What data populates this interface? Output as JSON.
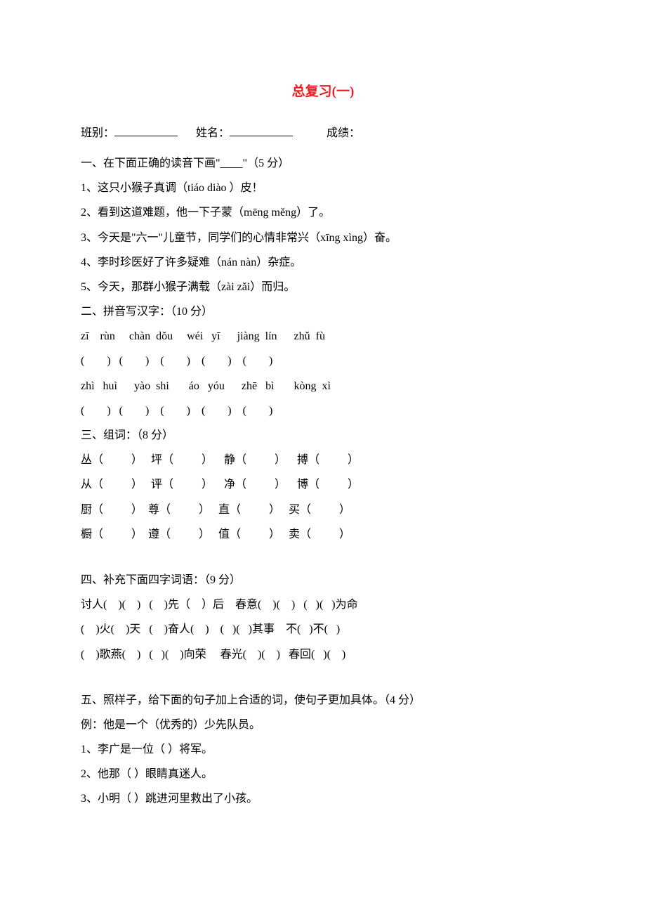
{
  "title": "总复习(一)",
  "header": {
    "class_label": "班别：",
    "name_label": "姓名：",
    "score_label": "成绩："
  },
  "section1": {
    "label": "一、在下面正确的读音下画\"____\"（5 分）",
    "items": [
      "1、这只小猴子真调（tiáo   diào  ）皮！",
      "2、看到这道难题，他一下子蒙（mēng  měng）了。",
      "3、今天是\"六一\"儿童节，同学们的心情非常兴（xīng xìng）奋。",
      "4、李时珍医好了许多疑难（nán   nàn）杂症。",
      "5、今天，那群小猴子满载（zài  zǎi）而归。"
    ]
  },
  "section2": {
    "label": "二、拼音写汉字：（10 分）",
    "row1_pinyin": "zī    rùn     chàn  dǒu     wéi   yī      jiàng  lín      zhǔ  fù",
    "row1_paren": "(        )   (        )    (        )    (        )    (        )",
    "row2_pinyin": "zhì   huì      yào  shi       áo   yóu      zhē   bì       kòng  xì",
    "row2_paren": "(        )   (        )    (        )    (        )    (        )"
  },
  "section3": {
    "label": "三、组词：（8 分）",
    "rows": [
      "丛（          ）   坪（          ）    静（          ）    搏（          ）",
      "从（          ）   评（          ）    净（          ）    博（          ）",
      "厨（          ）  尊（          ）   直（          ）   买（          ）",
      "橱（          ）  遵（          ）   值（          ）   卖（          ）"
    ]
  },
  "section4": {
    "label": "四、补充下面四字词语：（9 分）",
    "rows": [
      "讨人(    )(    )   (    )先（    ）后    春意(    )(    )   (   )(   )为命",
      "(    )火(    )天   (    )奋人(    )    (   )(   )其事    不(   )不(   )",
      "(    )歌燕(    )   (   )(    )向荣     春光(    )(    )   春回(   )(    )"
    ]
  },
  "section5": {
    "label": "五、照样子，给下面的句子加上合适的词，使句子更加具体。（4 分）",
    "example": "例：他是一个（优秀的）少先队员。",
    "items": [
      "1、李广是一位（          ）将军。",
      "2、他那（          ）眼睛真迷人。",
      "3、小明（          ）跳进河里救出了小孩。"
    ]
  }
}
